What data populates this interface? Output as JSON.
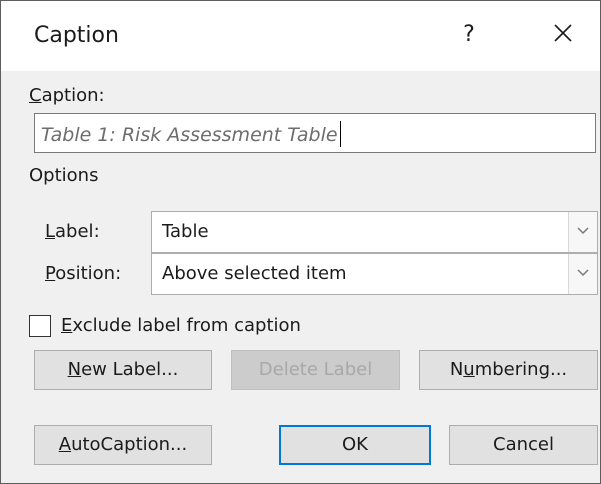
{
  "dialog": {
    "title": "Caption",
    "help": "?"
  },
  "caption": {
    "label_key": "C",
    "label_rest": "aption:",
    "value": "Table 1: Risk Assessment Table"
  },
  "options": {
    "heading": "Options",
    "label_field": {
      "key": "L",
      "rest": "abel:",
      "value": "Table"
    },
    "position_field": {
      "key": "P",
      "rest": "osition:",
      "value": "Above selected item"
    },
    "exclude": {
      "key": "E",
      "rest": "xclude label from caption",
      "checked": false
    }
  },
  "buttons": {
    "new_label": {
      "key": "N",
      "rest": "ew Label..."
    },
    "delete_label": "Delete Label",
    "numbering": {
      "pre": "N",
      "key": "u",
      "rest": "mbering..."
    },
    "autocaption": {
      "key": "A",
      "rest": "utoCaption..."
    },
    "ok": "OK",
    "cancel": "Cancel"
  },
  "icons": {
    "close": "close-icon",
    "dropdown": "chevron-down-icon"
  },
  "colors": {
    "accent": "#0078d7",
    "dialog_bg": "#f0f0f0",
    "disabled_text": "#a8a8a8"
  }
}
